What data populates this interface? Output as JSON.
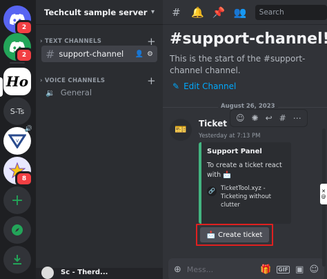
{
  "servers": [
    {
      "name": "discord-home",
      "label": "",
      "badge": "2",
      "color": "#5865f2"
    },
    {
      "name": "server-green",
      "label": "",
      "badge": "2",
      "color": "#23a559"
    },
    {
      "name": "server-ho",
      "label": "Ho",
      "badge": "",
      "color": "#ffffff"
    },
    {
      "name": "server-sts",
      "label": "S-Ts",
      "badge": "",
      "color": "#313338"
    },
    {
      "name": "server-gta",
      "label": "",
      "badge": "",
      "color": "#ffffff"
    },
    {
      "name": "server-star",
      "label": "",
      "badge": "8",
      "color": "#e8e8ff"
    }
  ],
  "rail_actions": {
    "add": "+",
    "explore": "",
    "download": ""
  },
  "server_header": {
    "title": "Techcult sample server"
  },
  "categories": {
    "text": "TEXT CHANNELS",
    "voice": "VOICE CHANNELS"
  },
  "channels": {
    "support": "support-channel",
    "general": "General"
  },
  "user_panel": {
    "name": "Sc - Therd..."
  },
  "search": {
    "placeholder": "Search"
  },
  "welcome": {
    "title": "#support-channel!",
    "description": "This is the start of the #support-channel channel.",
    "edit_link": "Edit Channel"
  },
  "divider_date": "August 26, 2023",
  "message": {
    "author": "Ticket Tool",
    "timestamp": "Yesterday at 7:13 PM",
    "embed": {
      "title": "Support Panel",
      "text": "To create a ticket react with",
      "field": "TicketTool.xyz - Ticketing without clutter"
    },
    "button_label": "Create ticket"
  },
  "composer": {
    "placeholder": "Mess..."
  },
  "colors": {
    "accent": "#5865f2",
    "link": "#00a8fc",
    "embed_bar": "#43b581",
    "highlight": "#e02020"
  }
}
